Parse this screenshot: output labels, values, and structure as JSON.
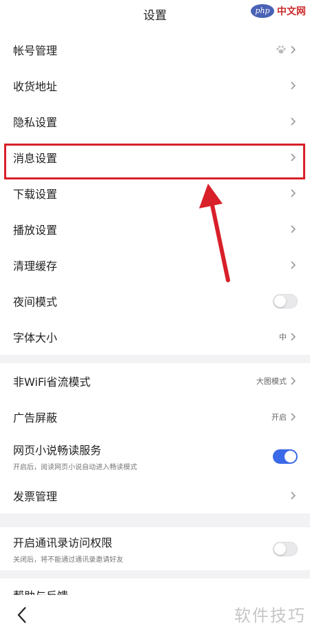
{
  "header": {
    "title": "设置"
  },
  "watermark_top": {
    "logo": "php",
    "text": "中文网"
  },
  "group1": [
    {
      "label": "帐号管理",
      "icon": "paw-icon"
    },
    {
      "label": "收货地址"
    },
    {
      "label": "隐私设置"
    },
    {
      "label": "消息设置"
    },
    {
      "label": "下载设置"
    },
    {
      "label": "播放设置"
    },
    {
      "label": "清理缓存"
    },
    {
      "label": "夜间模式",
      "toggle": false
    },
    {
      "label": "字体大小",
      "value": "中"
    }
  ],
  "group2": [
    {
      "label": "非WiFi省流模式",
      "value": "大图模式"
    },
    {
      "label": "广告屏蔽",
      "value": "开启"
    },
    {
      "label": "网页小说畅读服务",
      "sub": "开启后，阅读网页小说自动进入畅读模式",
      "toggle": true
    },
    {
      "label": "发票管理"
    }
  ],
  "group3": [
    {
      "label": "开启通讯录访问权限",
      "sub": "关闭后，将不能通过通讯录邀请好友",
      "toggle": false
    }
  ],
  "peek_item": {
    "label": "帮助与反馈"
  },
  "watermark_bottom": {
    "text": "软件技巧"
  },
  "colors": {
    "accent": "#3b6ae8",
    "highlight": "#d8202a"
  }
}
